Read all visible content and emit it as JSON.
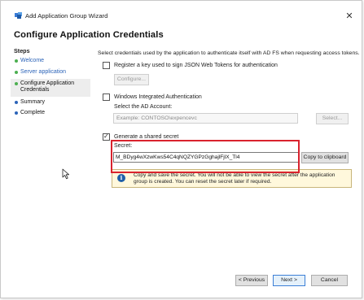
{
  "window": {
    "title": "Add Application Group Wizard",
    "close_glyph": "✕",
    "icon": "app-group-icon"
  },
  "page_title": "Configure Application Credentials",
  "steps": {
    "heading": "Steps",
    "items": [
      {
        "label": "Welcome",
        "state": "done"
      },
      {
        "label": "Server application",
        "state": "done"
      },
      {
        "label": "Configure Application Credentials",
        "state": "current"
      },
      {
        "label": "Summary",
        "state": "todo"
      },
      {
        "label": "Complete",
        "state": "todo"
      }
    ]
  },
  "content": {
    "intro": "Select credentials used by the application to authenticate itself with AD FS when requesting access tokens.",
    "register_key": {
      "label": "Register a key used to sign JSON Web Tokens for authentication",
      "checked": false,
      "configure_button": "Configure..."
    },
    "windows_auth": {
      "label": "Windows Integrated Authentication",
      "checked": false,
      "select_account_label": "Select the AD Account:",
      "account_placeholder": "Example: CONTOSO\\expencevc",
      "select_button": "Select..."
    },
    "shared_secret": {
      "label": "Generate a shared secret",
      "checked": true,
      "secret_label": "Secret:",
      "secret_value": "M_BDyg4wXzwKws54C4qNQZYGPzGghajlFjlX_Tl4",
      "copy_button": "Copy to clipboard"
    },
    "info": {
      "icon": "info-icon",
      "text": "Copy and save the secret.  You will not be able to view the secret after the application group is created.  You can reset the secret later if required."
    }
  },
  "footer": {
    "previous": "< Previous",
    "next": "Next >",
    "cancel": "Cancel"
  },
  "colors": {
    "accent_link": "#2b63b8",
    "highlight": "#d9232e",
    "info_bg": "#fff8dc"
  }
}
